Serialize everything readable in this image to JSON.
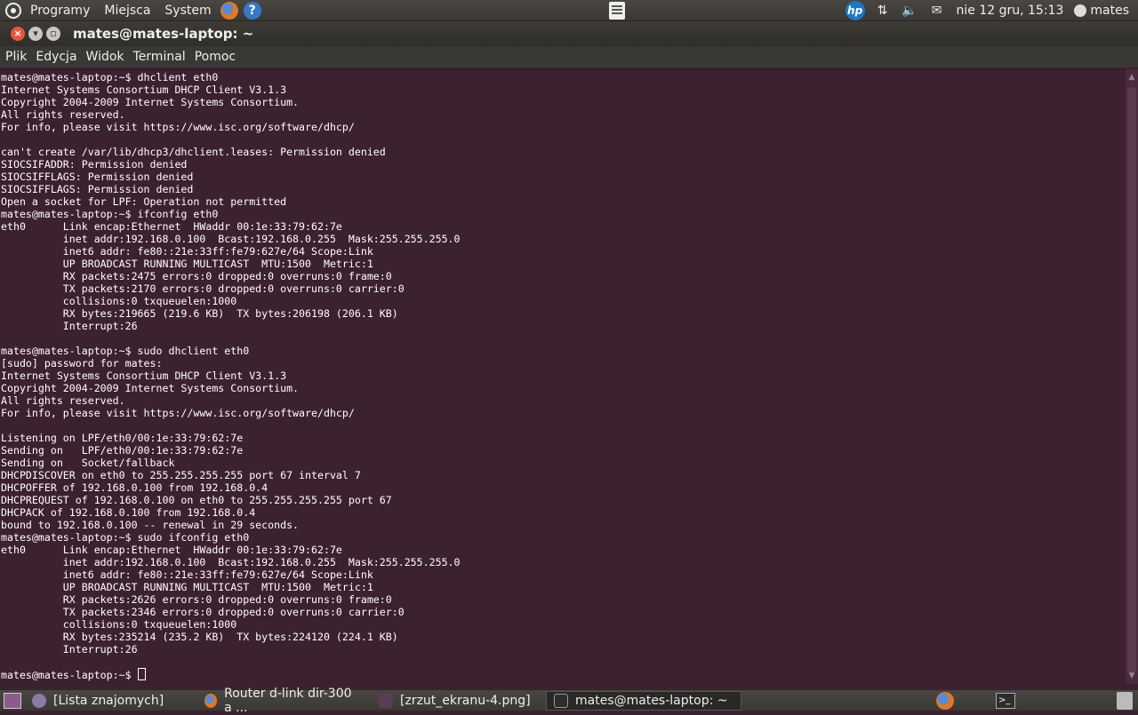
{
  "top_panel": {
    "menus": [
      "Programy",
      "Miejsca",
      "System"
    ],
    "clock": "nie 12 gru, 15:13",
    "user": "mates",
    "icons": [
      "ubuntu-logo",
      "firefox-icon",
      "help-icon",
      "notes-icon",
      "hp-icon",
      "network-icon",
      "volume-icon",
      "mail-icon",
      "user-icon"
    ]
  },
  "window": {
    "title": "mates@mates-laptop: ~",
    "menu": [
      "Plik",
      "Edycja",
      "Widok",
      "Terminal",
      "Pomoc"
    ]
  },
  "terminal": {
    "lines": [
      "mates@mates-laptop:~$ dhclient eth0",
      "Internet Systems Consortium DHCP Client V3.1.3",
      "Copyright 2004-2009 Internet Systems Consortium.",
      "All rights reserved.",
      "For info, please visit https://www.isc.org/software/dhcp/",
      "",
      "can't create /var/lib/dhcp3/dhclient.leases: Permission denied",
      "SIOCSIFADDR: Permission denied",
      "SIOCSIFFLAGS: Permission denied",
      "SIOCSIFFLAGS: Permission denied",
      "Open a socket for LPF: Operation not permitted",
      "mates@mates-laptop:~$ ifconfig eth0",
      "eth0      Link encap:Ethernet  HWaddr 00:1e:33:79:62:7e  ",
      "          inet addr:192.168.0.100  Bcast:192.168.0.255  Mask:255.255.255.0",
      "          inet6 addr: fe80::21e:33ff:fe79:627e/64 Scope:Link",
      "          UP BROADCAST RUNNING MULTICAST  MTU:1500  Metric:1",
      "          RX packets:2475 errors:0 dropped:0 overruns:0 frame:0",
      "          TX packets:2170 errors:0 dropped:0 overruns:0 carrier:0",
      "          collisions:0 txqueuelen:1000 ",
      "          RX bytes:219665 (219.6 KB)  TX bytes:206198 (206.1 KB)",
      "          Interrupt:26 ",
      "",
      "mates@mates-laptop:~$ sudo dhclient eth0",
      "[sudo] password for mates: ",
      "Internet Systems Consortium DHCP Client V3.1.3",
      "Copyright 2004-2009 Internet Systems Consortium.",
      "All rights reserved.",
      "For info, please visit https://www.isc.org/software/dhcp/",
      "",
      "Listening on LPF/eth0/00:1e:33:79:62:7e",
      "Sending on   LPF/eth0/00:1e:33:79:62:7e",
      "Sending on   Socket/fallback",
      "DHCPDISCOVER on eth0 to 255.255.255.255 port 67 interval 7",
      "DHCPOFFER of 192.168.0.100 from 192.168.0.4",
      "DHCPREQUEST of 192.168.0.100 on eth0 to 255.255.255.255 port 67",
      "DHCPACK of 192.168.0.100 from 192.168.0.4",
      "bound to 192.168.0.100 -- renewal in 29 seconds.",
      "mates@mates-laptop:~$ sudo ifconfig eth0",
      "eth0      Link encap:Ethernet  HWaddr 00:1e:33:79:62:7e  ",
      "          inet addr:192.168.0.100  Bcast:192.168.0.255  Mask:255.255.255.0",
      "          inet6 addr: fe80::21e:33ff:fe79:627e/64 Scope:Link",
      "          UP BROADCAST RUNNING MULTICAST  MTU:1500  Metric:1",
      "          RX packets:2626 errors:0 dropped:0 overruns:0 frame:0",
      "          TX packets:2346 errors:0 dropped:0 overruns:0 carrier:0",
      "          collisions:0 txqueuelen:1000 ",
      "          RX bytes:235214 (235.2 KB)  TX bytes:224120 (224.1 KB)",
      "          Interrupt:26 ",
      "",
      "mates@mates-laptop:~$ "
    ]
  },
  "taskbar": {
    "tasks": [
      {
        "label": "[Lista znajomych]",
        "icon": "pidgin-icon"
      },
      {
        "label": "Router d-link dir-300 a ...",
        "icon": "firefox-icon"
      },
      {
        "label": "[zrzut_ekranu-4.png]",
        "icon": "image-viewer-icon"
      },
      {
        "label": "mates@mates-laptop: ~",
        "icon": "terminal-icon",
        "active": true
      }
    ]
  }
}
